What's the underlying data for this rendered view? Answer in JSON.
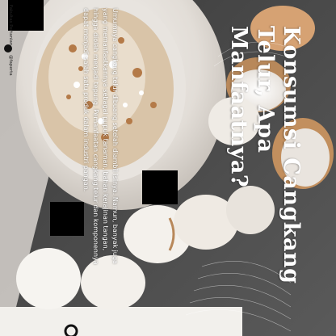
{
  "title": "Konsumsi Cangkang Telur, Apa Manfaatnya?",
  "body": "Umumnya cangkang telur dibuang setelah diambil isinya. Namun, banyak juga yang memanfaatkannya sebagai pupuk tanaman, bahan kerajinan tangan, hingga diolah menjadi tepung. Pemanfaatan cangkang telur dan komponennya dapat menjadi salah satu produk dalam industri pangan.",
  "social": {
    "handle_1": "Fakultas Pertanian",
    "handle_2": "@faperta"
  },
  "colors": {
    "text": "#ffffff",
    "bowl": "#e9e6e2",
    "cloth": "#4a4a4a",
    "shell_brown": "#b8885a"
  }
}
